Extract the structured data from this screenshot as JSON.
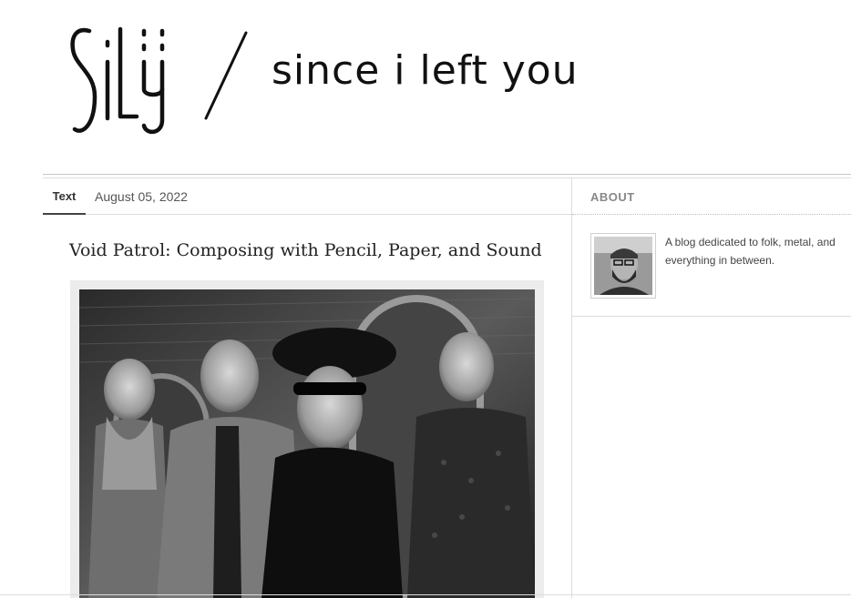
{
  "site": {
    "logo_letters": "SiLY",
    "tagline": "since i left you"
  },
  "post": {
    "type_label": "Text",
    "date": "August 05, 2022",
    "title": "Void Patrol: Composing with Pencil, Paper, and Sound"
  },
  "sidebar": {
    "about_heading": "ABOUT",
    "about_text": "A blog dedicated to folk, metal, and everything in between."
  }
}
